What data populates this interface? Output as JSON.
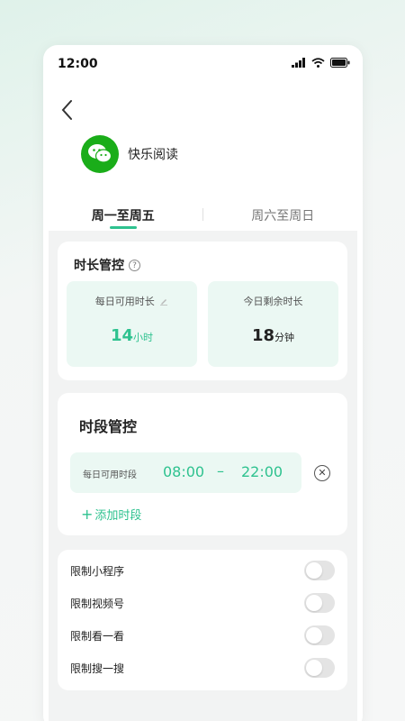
{
  "status_bar": {
    "time": "12:00"
  },
  "app": {
    "name": "快乐阅读",
    "icon": "wechat-icon"
  },
  "tabs": [
    {
      "label": "周一至周五",
      "active": true
    },
    {
      "label": "周六至周日",
      "active": false
    }
  ],
  "duration_control": {
    "title": "时长管控",
    "daily_available": {
      "label": "每日可用时长",
      "value": "14",
      "unit": "小时"
    },
    "today_remaining": {
      "label": "今日剩余时长",
      "value": "18",
      "unit": "分钟"
    }
  },
  "period_control": {
    "title": "时段管控",
    "periods": [
      {
        "label": "每日可用时段",
        "start": "08:00",
        "separator": "–",
        "end": "22:00"
      }
    ],
    "add_label": "添加时段"
  },
  "restrictions": [
    {
      "label": "限制小程序",
      "enabled": false
    },
    {
      "label": "限制视频号",
      "enabled": false
    },
    {
      "label": "限制看一看",
      "enabled": false
    },
    {
      "label": "限制搜一搜",
      "enabled": false
    }
  ],
  "colors": {
    "accent": "#2ec28f",
    "box_bg": "#ebf8f3",
    "app_icon": "#1aad19"
  }
}
